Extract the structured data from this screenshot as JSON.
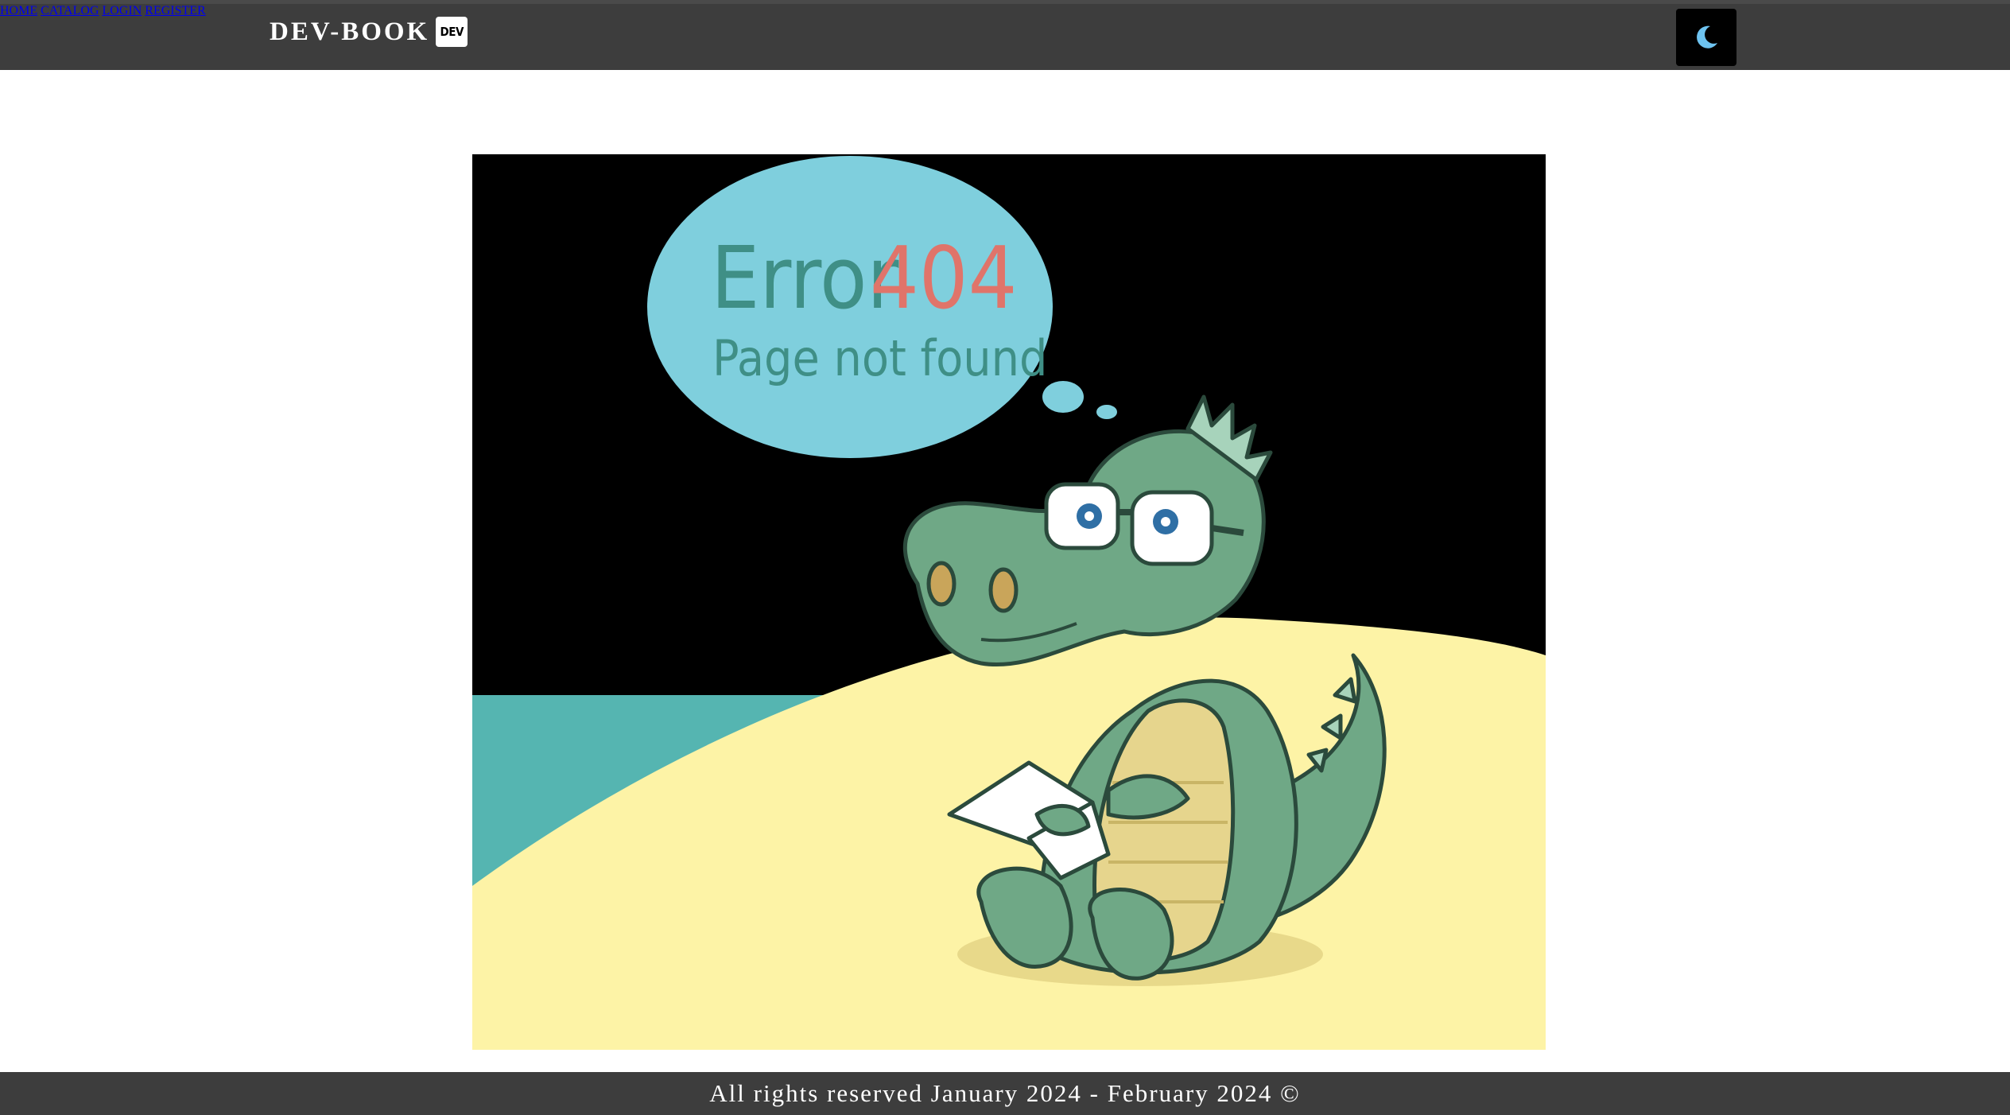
{
  "header": {
    "brand": "DEV-BOOK",
    "brand_badge": "DEV",
    "nav": [
      {
        "label": "HOME"
      },
      {
        "label": "CATALOG"
      },
      {
        "label": "LOGIN"
      },
      {
        "label": "REGISTER"
      }
    ],
    "theme_toggle_icon": "moon-icon"
  },
  "main": {
    "illustration": {
      "error_word": "Error",
      "error_code": "404",
      "message": "Page not found"
    }
  },
  "footer": {
    "text": "All rights reserved January 2024 - February 2024 ©"
  },
  "colors": {
    "header_bg": "#3d3d3d",
    "nav_link": "#1fa37a",
    "bubble": "#7fcfdd",
    "sea": "#55b5b1",
    "sand": "#fdf3a6",
    "croc": "#6fa886"
  }
}
